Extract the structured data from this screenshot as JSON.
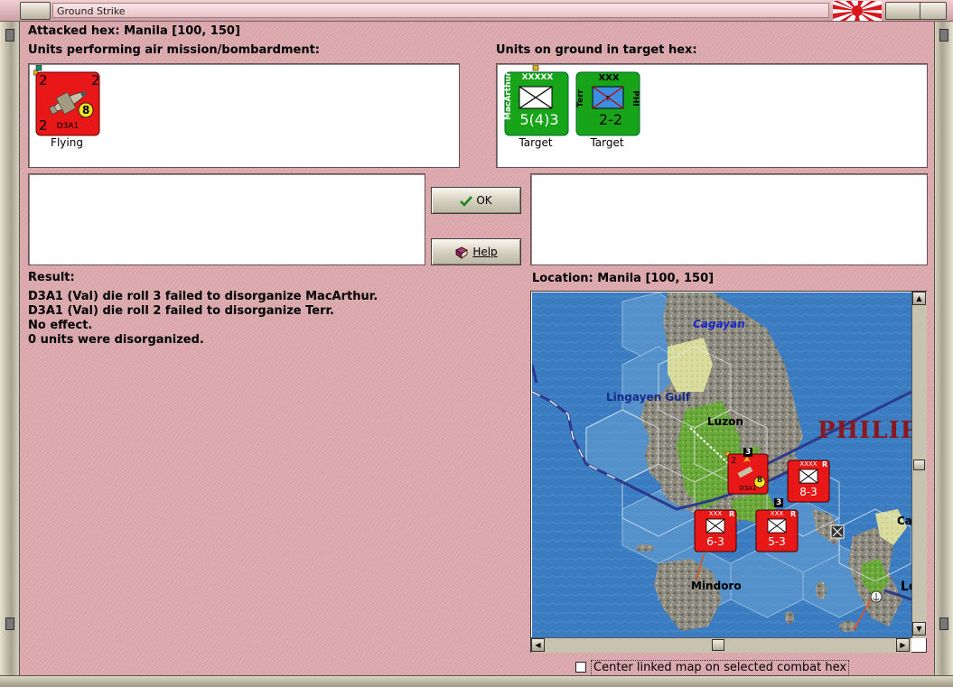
{
  "window": {
    "title": "Ground Strike"
  },
  "header": {
    "attacked_hex": "Attacked hex: Manila  [100, 150]"
  },
  "air_panel": {
    "label": "Units performing air mission/bombardment:",
    "units": [
      {
        "name": "D3A1",
        "counter_color": "#e81818",
        "top_left": "2",
        "top_right": "2",
        "bottom_left": "2",
        "range": "8",
        "caption": "Flying"
      }
    ]
  },
  "ground_panel": {
    "label": "Units on ground in target hex:",
    "units": [
      {
        "name": "MacArthur",
        "size": "XXXXX",
        "strength": "5(4)3",
        "counter_color": "#18a418",
        "caption": "Target"
      },
      {
        "name": "Terr",
        "side_label": "PHI",
        "size": "XXX",
        "strength": "2-2",
        "counter_color": "#18a418",
        "caption": "Target"
      }
    ]
  },
  "buttons": {
    "ok": "OK",
    "help": "Help"
  },
  "result": {
    "label": "Result:",
    "lines": [
      "D3A1 (Val) die roll 3 failed to disorganize MacArthur.",
      "D3A1 (Val) die roll 2 failed to disorganize Terr.",
      "No effect.",
      "0 units were disorganized."
    ]
  },
  "location": {
    "label": "Location:  Manila  [100, 150]"
  },
  "map": {
    "place_labels": {
      "cagayan": "Cagayan",
      "lingayen": "Lingayen Gulf",
      "luzon": "Luzon",
      "philip": "PHILIP",
      "mindoro": "Mindoro",
      "ca": "Ca",
      "le": "Le"
    },
    "stack_count_1": "3",
    "stack_count_2": "3",
    "counters": [
      {
        "size": "XXXX",
        "strength": "8-3",
        "tag": "R"
      },
      {
        "size": "XXX",
        "strength": "6-3",
        "tag": "R"
      },
      {
        "size": "XXX",
        "strength": "5-3",
        "tag": "R"
      }
    ],
    "air_counter": {
      "name": "D3A1",
      "top_left": "2",
      "range": "8"
    }
  },
  "footer": {
    "center_checkbox_label": "Center linked map on selected combat hex",
    "center_checkbox_checked": false
  },
  "colors": {
    "background": "#dba9ad",
    "axis_red": "#e81818",
    "allied_green": "#18a418",
    "sea": "#2f6fae",
    "land": "#8a8a7a",
    "jungle": "#6aa83c"
  }
}
